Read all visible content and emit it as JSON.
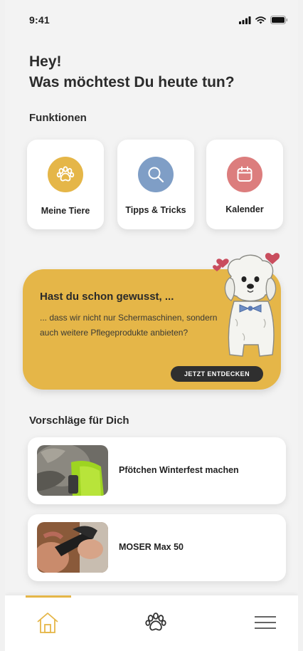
{
  "status_bar": {
    "time": "9:41"
  },
  "greeting": {
    "line1": "Hey!",
    "line2": "Was möchtest Du heute tun?"
  },
  "functions": {
    "title": "Funktionen",
    "items": [
      {
        "label": "Meine Tiere",
        "icon": "paw-icon",
        "color": "#e5b648"
      },
      {
        "label": "Tipps & Tricks",
        "icon": "search-icon",
        "color": "#7f9ec6"
      },
      {
        "label": "Kalender",
        "icon": "calendar-icon",
        "color": "#dc7d7d"
      }
    ]
  },
  "banner": {
    "title": "Hast du schon gewusst, ...",
    "text": "... dass wir nicht nur Schermaschinen, sondern auch weitere Pflegeprodukte anbieten?",
    "button_label": "JETZT ENTDECKEN",
    "color": "#e5b648"
  },
  "suggestions": {
    "title": "Vorschläge für Dich",
    "items": [
      {
        "label": "Pfötchen Winterfest machen"
      },
      {
        "label": "MOSER Max 50"
      }
    ]
  },
  "tab_bar": {
    "active": "home",
    "accent": "#e5b648",
    "items": [
      "home-icon",
      "paw-icon",
      "menu-icon"
    ]
  }
}
